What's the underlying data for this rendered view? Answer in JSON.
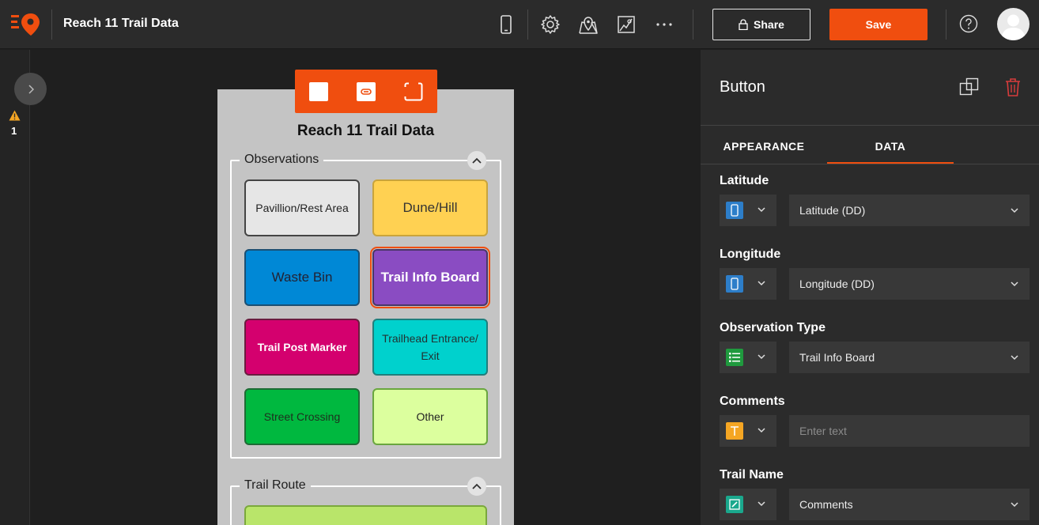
{
  "header": {
    "app_title": "Reach 11 Trail Data",
    "share_label": "Share",
    "save_label": "Save",
    "icons": [
      "survey123-logo",
      "device-preview-icon",
      "settings-icon",
      "map-pin-icon",
      "map-icon",
      "more-icon",
      "lock-icon",
      "help-icon",
      "avatar"
    ]
  },
  "left_rail": {
    "warning_count": "1"
  },
  "form": {
    "title": "Reach 11 Trail Data",
    "observations_group": {
      "label": "Observations",
      "buttons": [
        {
          "label": "Pavillion/Rest Area",
          "color": "#e6e6e6"
        },
        {
          "label": "Dune/Hill",
          "color": "#ffd152"
        },
        {
          "label": "Waste Bin",
          "color": "#0088d6"
        },
        {
          "label": "Trail Info Board",
          "color": "#8a4cc2",
          "selected": true
        },
        {
          "label": "Trail Post Marker",
          "color": "#d4006e"
        },
        {
          "label": "Trailhead Entrance/ Exit",
          "color": "#00d1cd"
        },
        {
          "label": "Street Crossing",
          "color": "#00b83f"
        },
        {
          "label": "Other",
          "color": "#dcff9e"
        }
      ]
    },
    "trail_route_group": {
      "label": "Trail Route"
    }
  },
  "panel": {
    "title": "Button",
    "tabs": [
      {
        "label": "APPEARANCE",
        "active": false
      },
      {
        "label": "DATA",
        "active": true
      }
    ],
    "fields": [
      {
        "label": "Latitude",
        "type_icon": "mobile-icon",
        "value": "Latitude (DD)"
      },
      {
        "label": "Longitude",
        "type_icon": "mobile-icon",
        "value": "Longitude (DD)"
      },
      {
        "label": "Observation Type",
        "type_icon": "list-icon",
        "value": "Trail Info Board"
      },
      {
        "label": "Comments",
        "type_icon": "text-icon",
        "placeholder": "Enter text"
      },
      {
        "label": "Trail Name",
        "type_icon": "edit-icon",
        "value": "Comments"
      }
    ]
  },
  "colors": {
    "accent": "#f04e0f",
    "panel_bg": "#2b2b2b",
    "canvas_bg": "#1f1f1f"
  }
}
